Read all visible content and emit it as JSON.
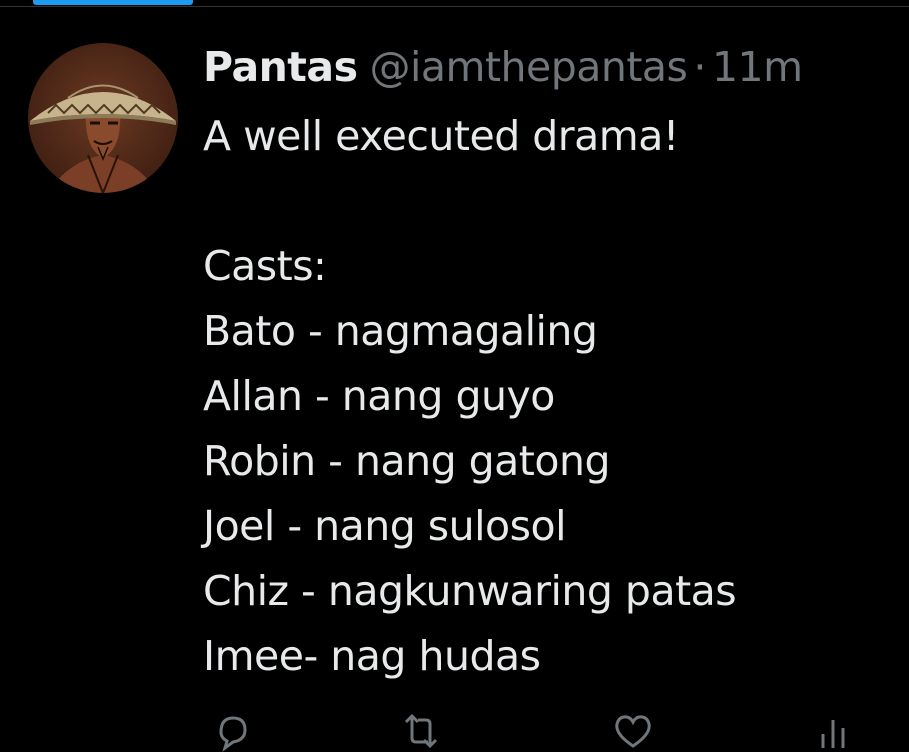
{
  "tweet": {
    "display_name": "Pantas",
    "handle": "@iamthepantas",
    "separator": "·",
    "time": "11m",
    "lines": [
      "A well executed drama!",
      "",
      "Casts:",
      "Bato - nagmagaling",
      "Allan - nang guyo",
      "Robin - nang gatong",
      "Joel - nang sulosol",
      "Chiz - nagkunwaring patas",
      "Imee- nag hudas"
    ]
  },
  "icons": {
    "avatar": "avatar-image",
    "actions": [
      "reply-icon",
      "retweet-icon",
      "like-icon",
      "views-icon"
    ]
  },
  "colors": {
    "background": "#000000",
    "text_primary": "#e7e9ea",
    "text_secondary": "#71767b",
    "accent": "#1d9bf0"
  }
}
